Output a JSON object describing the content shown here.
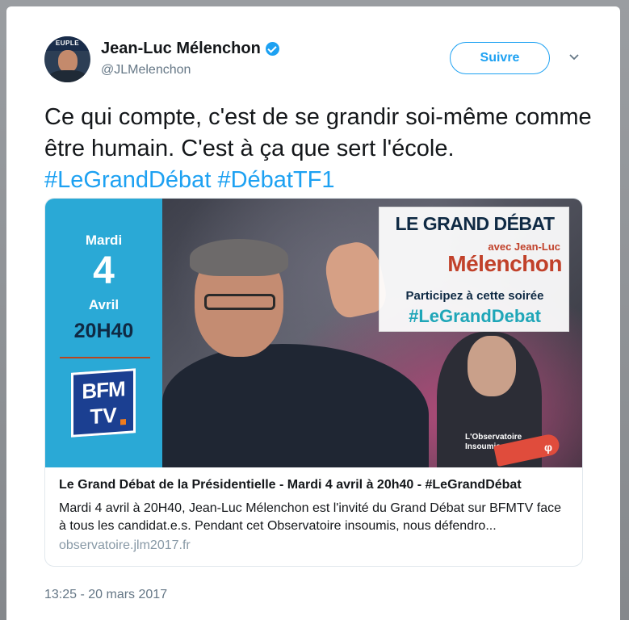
{
  "user": {
    "display_name": "Jean-Luc Mélenchon",
    "handle": "@JLMelenchon",
    "avatar_band_text": "EUPLE"
  },
  "actions": {
    "follow_label": "Suivre"
  },
  "tweet": {
    "text": "Ce qui compte, c'est de se grandir soi-même comme être humain. C'est à ça que sert l'école.",
    "hashtag1": "#LeGrandDébat",
    "hashtag2": "#DébatTF1",
    "timestamp": "13:25 - 20 mars 2017"
  },
  "card": {
    "image": {
      "day": "Mardi",
      "date_number": "4",
      "month": "Avril",
      "time": "20H40",
      "channel_line1": "BFM",
      "channel_line2": "TV",
      "overlay_title": "LE GRAND DÉBAT",
      "overlay_avec": "avec Jean-Luc",
      "overlay_name": "Mélenchon",
      "overlay_participate": "Participez à cette soirée",
      "overlay_hashtag": "#LeGrandDebat",
      "observatoire_line1": "L'Observatoire",
      "observatoire_line2": "Insoumis",
      "observatoire_symbol": "φ"
    },
    "title": "Le Grand Débat de la Présidentielle - Mardi 4 avril à 20h40 - #LeGrandDébat",
    "description": "Mardi 4 avril à 20H40, Jean-Luc Mélenchon est l'invité du Grand Débat sur BFMTV face à tous les candidat.e.s. Pendant cet Observatoire insoumis, nous défendro...",
    "url": "observatoire.jlm2017.fr"
  },
  "colors": {
    "link_blue": "#1da1f2",
    "panel_blue": "#2aa9d6",
    "accent_red": "#c1412a"
  },
  "icons": {
    "verified": "verified-badge-icon",
    "chevron": "chevron-down-icon"
  }
}
